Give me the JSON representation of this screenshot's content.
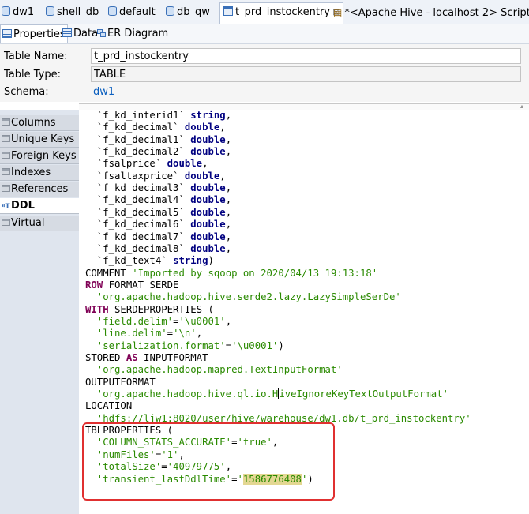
{
  "editor_tabs": [
    {
      "label": "dw1",
      "icon": "database-icon"
    },
    {
      "label": "shell_db",
      "icon": "database-icon"
    },
    {
      "label": "default",
      "icon": "database-icon"
    },
    {
      "label": "db_qw",
      "icon": "database-icon"
    },
    {
      "label": "t_prd_instockentry",
      "icon": "table-icon",
      "close": "⊠"
    },
    {
      "label": "*<Apache Hive - localhost 2> Script",
      "icon": "sql-script-icon"
    }
  ],
  "sub_tabs": [
    "Properties",
    "Data",
    "ER Diagram"
  ],
  "properties": {
    "table_name_label": "Table Name:",
    "table_name_value": "t_prd_instockentry",
    "table_type_label": "Table Type:",
    "table_type_value": "TABLE",
    "schema_label": "Schema:",
    "schema_value": "dw1"
  },
  "nav_items": [
    "Columns",
    "Unique Keys",
    "Foreign Keys",
    "Indexes",
    "References",
    "DDL",
    "Virtual"
  ],
  "selected_nav": "DDL",
  "ddl_lines": [
    [
      [
        "p",
        "  `f_kd_interid1` "
      ],
      [
        "t",
        "string"
      ],
      [
        "p",
        ","
      ]
    ],
    [
      [
        "p",
        "  `f_kd_decimal` "
      ],
      [
        "t",
        "double"
      ],
      [
        "p",
        ","
      ]
    ],
    [
      [
        "p",
        "  `f_kd_decimal1` "
      ],
      [
        "t",
        "double"
      ],
      [
        "p",
        ","
      ]
    ],
    [
      [
        "p",
        "  `f_kd_decimal2` "
      ],
      [
        "t",
        "double"
      ],
      [
        "p",
        ","
      ]
    ],
    [
      [
        "p",
        "  `fsalprice` "
      ],
      [
        "t",
        "double"
      ],
      [
        "p",
        ","
      ]
    ],
    [
      [
        "p",
        "  `fsaltaxprice` "
      ],
      [
        "t",
        "double"
      ],
      [
        "p",
        ","
      ]
    ],
    [
      [
        "p",
        "  `f_kd_decimal3` "
      ],
      [
        "t",
        "double"
      ],
      [
        "p",
        ","
      ]
    ],
    [
      [
        "p",
        "  `f_kd_decimal4` "
      ],
      [
        "t",
        "double"
      ],
      [
        "p",
        ","
      ]
    ],
    [
      [
        "p",
        "  `f_kd_decimal5` "
      ],
      [
        "t",
        "double"
      ],
      [
        "p",
        ","
      ]
    ],
    [
      [
        "p",
        "  `f_kd_decimal6` "
      ],
      [
        "t",
        "double"
      ],
      [
        "p",
        ","
      ]
    ],
    [
      [
        "p",
        "  `f_kd_decimal7` "
      ],
      [
        "t",
        "double"
      ],
      [
        "p",
        ","
      ]
    ],
    [
      [
        "p",
        "  `f_kd_decimal8` "
      ],
      [
        "t",
        "double"
      ],
      [
        "p",
        ","
      ]
    ],
    [
      [
        "p",
        "  `f_kd_text4` "
      ],
      [
        "t",
        "string"
      ],
      [
        "p",
        ")"
      ]
    ],
    [
      [
        "p",
        "COMMENT "
      ],
      [
        "s",
        "'Imported by sqoop on 2020/04/13 19:13:18'"
      ]
    ],
    [
      [
        "k",
        "ROW"
      ],
      [
        "p",
        " FORMAT SERDE"
      ]
    ],
    [
      [
        "s",
        "  'org.apache.hadoop.hive.serde2.lazy.LazySimpleSerDe'"
      ]
    ],
    [
      [
        "k",
        "WITH"
      ],
      [
        "p",
        " SERDEPROPERTIES ("
      ]
    ],
    [
      [
        "s",
        "  'field.delim'"
      ],
      [
        "p",
        "="
      ],
      [
        "s",
        "'\\u0001'"
      ],
      [
        "p",
        ","
      ]
    ],
    [
      [
        "s",
        "  'line.delim'"
      ],
      [
        "p",
        "="
      ],
      [
        "s",
        "'\\n'"
      ],
      [
        "p",
        ","
      ]
    ],
    [
      [
        "s",
        "  'serialization.format'"
      ],
      [
        "p",
        "="
      ],
      [
        "s",
        "'\\u0001'"
      ],
      [
        "p",
        ")"
      ]
    ],
    [
      [
        "p",
        "STORED "
      ],
      [
        "k",
        "AS"
      ],
      [
        "p",
        " INPUTFORMAT"
      ]
    ],
    [
      [
        "s",
        "  'org.apache.hadoop.mapred.TextInputFormat'"
      ]
    ],
    [
      [
        "p",
        "OUTPUTFORMAT"
      ]
    ],
    [
      [
        "s",
        "  'org.apache.hadoop.hive.ql.io.H"
      ],
      [
        "c",
        ""
      ],
      [
        "s",
        "iveIgnoreKeyTextOutputFormat'"
      ]
    ],
    [
      [
        "p",
        "LOCATION"
      ]
    ],
    [
      [
        "s",
        "  'hdfs://ljw1:8020/user/hive/warehouse/dw1.db/t_prd_instockentry'"
      ]
    ],
    [
      [
        "p",
        "TBLPROPERTIES ("
      ]
    ],
    [
      [
        "s",
        "  'COLUMN_STATS_ACCURATE'"
      ],
      [
        "p",
        "="
      ],
      [
        "s",
        "'true'"
      ],
      [
        "p",
        ","
      ]
    ],
    [
      [
        "s",
        "  'numFiles'"
      ],
      [
        "p",
        "="
      ],
      [
        "s",
        "'1'"
      ],
      [
        "p",
        ","
      ]
    ],
    [
      [
        "s",
        "  'totalSize'"
      ],
      [
        "p",
        "="
      ],
      [
        "s",
        "'40979775'"
      ],
      [
        "p",
        ","
      ]
    ],
    [
      [
        "s",
        "  'transient_lastDdlTime'"
      ],
      [
        "p",
        "="
      ],
      [
        "s",
        "'"
      ],
      [
        "h",
        "1586776408"
      ],
      [
        "s",
        "'"
      ],
      [
        "p",
        ")"
      ]
    ]
  ],
  "colors": {
    "keyword": "#7f0055",
    "type": "#000080",
    "string": "#2a8a00",
    "highlight_box": "#e03030"
  }
}
